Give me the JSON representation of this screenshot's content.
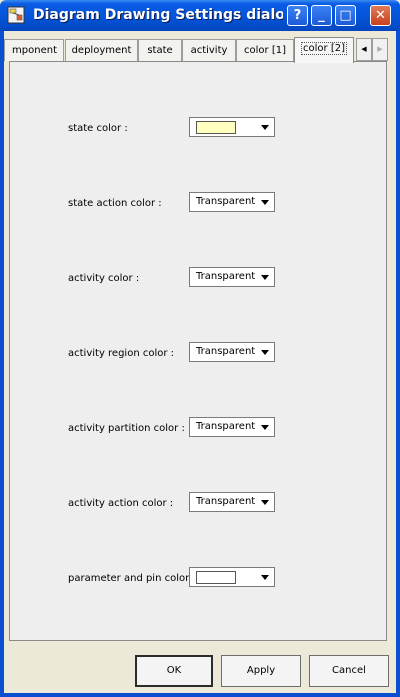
{
  "window": {
    "title": "Diagram Drawing Settings dialog",
    "controls": {
      "help": "?",
      "minimize": "_",
      "maximize": "□",
      "close": "✕"
    }
  },
  "tabs": [
    {
      "label": "mponent",
      "active": false
    },
    {
      "label": "deployment",
      "active": false
    },
    {
      "label": "state",
      "active": false
    },
    {
      "label": "activity",
      "active": false
    },
    {
      "label": "color [1]",
      "active": false
    },
    {
      "label": "color [2]",
      "active": true
    }
  ],
  "tab_scroll": {
    "left": "◀",
    "right": "▶"
  },
  "settings": [
    {
      "label": "state color :",
      "value": "",
      "swatch": "#ffffc0"
    },
    {
      "label": "state action color :",
      "value": "Transparent"
    },
    {
      "label": "activity color :",
      "value": "Transparent"
    },
    {
      "label": "activity region color :",
      "value": "Transparent"
    },
    {
      "label": "activity partition color :",
      "value": "Transparent"
    },
    {
      "label": "activity action color :",
      "value": "Transparent"
    },
    {
      "label": "parameter and pin color :",
      "value": "",
      "swatch": "#ffffff"
    }
  ],
  "buttons": {
    "ok": "OK",
    "apply": "Apply",
    "cancel": "Cancel"
  }
}
